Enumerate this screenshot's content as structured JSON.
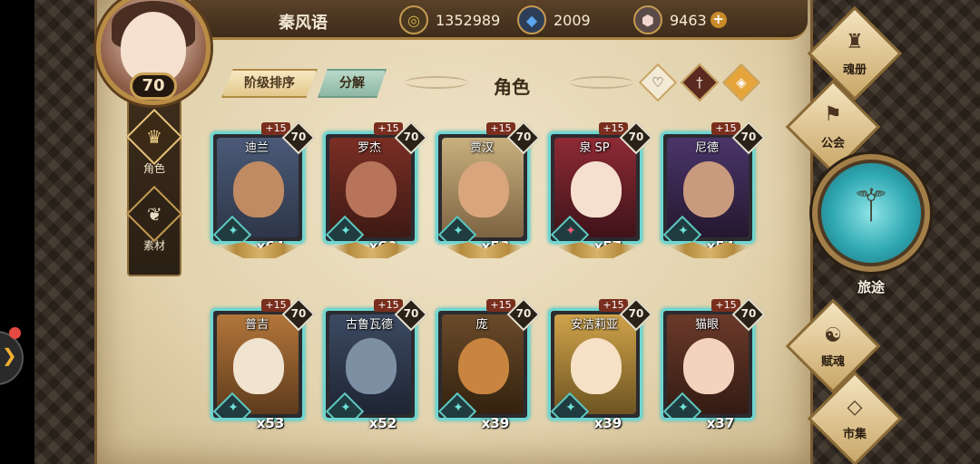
{
  "player": {
    "name": "秦风语",
    "level": "70"
  },
  "resources": [
    {
      "icon": "gold-coin-icon",
      "value": "1352989",
      "color": "#d9b24a"
    },
    {
      "icon": "blue-crystal-icon",
      "value": "2009",
      "color": "#3f8fe0"
    },
    {
      "icon": "pink-gem-icon",
      "value": "9463",
      "color": "#e8c7c0",
      "plus": "+"
    }
  ],
  "sidebar": {
    "items": [
      {
        "label": "角色",
        "icon": "character-icon"
      },
      {
        "label": "素材",
        "icon": "material-icon"
      }
    ]
  },
  "toolbar": {
    "sort_label": "阶级排序",
    "decompose_label": "分解",
    "title": "角色"
  },
  "filters": [
    {
      "icon": "heart-filter-icon"
    },
    {
      "icon": "sword-filter-icon"
    },
    {
      "icon": "shield-filter-icon"
    }
  ],
  "cards": [
    {
      "name": "迪兰",
      "level": "70",
      "plus": "+15",
      "count": "x64",
      "bg": "#4b5a78",
      "face": "#c08a63"
    },
    {
      "name": "罗杰",
      "level": "70",
      "plus": "+15",
      "count": "x60",
      "bg": "#7a2e24",
      "face": "#b8745a"
    },
    {
      "name": "贾汉",
      "level": "70",
      "plus": "+15",
      "count": "x58",
      "bg": "#c9b07e",
      "face": "#d9a57d"
    },
    {
      "name": "泉 SP",
      "level": "70",
      "plus": "+15",
      "count": "x57",
      "bg": "#8e2a35",
      "face": "#f6dfcf"
    },
    {
      "name": "尼德",
      "level": "70",
      "plus": "+15",
      "count": "x54",
      "bg": "#4b356a",
      "face": "#c99b7e"
    },
    {
      "name": "普吉",
      "level": "70",
      "plus": "+15",
      "count": "x53",
      "bg": "#b3763a",
      "face": "#f0e3cf"
    },
    {
      "name": "古鲁瓦德",
      "level": "70",
      "plus": "+15",
      "count": "x52",
      "bg": "#3d4a62",
      "face": "#7d8fa3"
    },
    {
      "name": "庞",
      "level": "70",
      "plus": "+15",
      "count": "x39",
      "bg": "#6a4a2a",
      "face": "#c9853f"
    },
    {
      "name": "安洁莉亚",
      "level": "70",
      "plus": "+15",
      "count": "x39",
      "bg": "#d0a34a",
      "face": "#f7e1c6"
    },
    {
      "name": "猫眼",
      "level": "70",
      "plus": "+15",
      "count": "x37",
      "bg": "#6b3a2a",
      "face": "#f3d3bd"
    }
  ],
  "nav": [
    {
      "label": "魂册",
      "icon": "soul-book-icon"
    },
    {
      "label": "公会",
      "icon": "guild-icon"
    },
    {
      "label": "旅途",
      "icon": "journey-icon"
    },
    {
      "label": "赋魂",
      "icon": "soul-infuse-icon"
    },
    {
      "label": "市集",
      "icon": "market-icon"
    }
  ],
  "colors": {
    "card_border": "#6fd6d0",
    "accent": "#c59b52"
  }
}
